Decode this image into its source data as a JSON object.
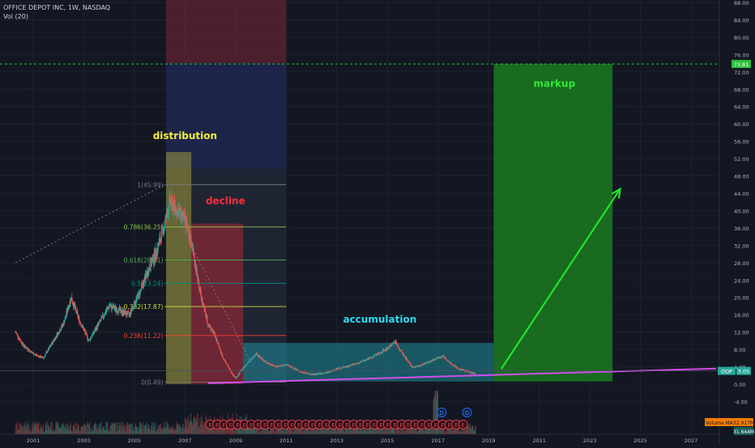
{
  "header": {
    "symbol_line": "OFFICE DEPOT INC, 1W, NASDAQ",
    "volume_line": "Vol (20)"
  },
  "colors": {
    "background": "#131722",
    "grid": "#1e2230",
    "axis_text": "#b2b5be",
    "up_candle": "#26a69a",
    "down_candle": "#ef5350",
    "trendline": "#d24ee8",
    "arrow": "#22e32a",
    "target_line": "#2fbf3c"
  },
  "chart_data": {
    "type": "candlestick",
    "title": "OFFICE DEPOT INC, 1W, NASDAQ",
    "ylim": [
      0,
      88
    ],
    "xlim": [
      2000.3,
      2028.0
    ],
    "y_ticks": [
      "-4.00",
      "0.00",
      "4.00",
      "8.00",
      "12.00",
      "16.00",
      "20.00",
      "24.00",
      "28.00",
      "32.00",
      "36.00",
      "40.00",
      "44.00",
      "48.00",
      "52.00",
      "56.00",
      "60.00",
      "64.00",
      "68.00",
      "72.00",
      "76.00",
      "80.00",
      "84.00",
      "88.00"
    ],
    "x_ticks": [
      "2001",
      "2003",
      "2005",
      "2007",
      "2009",
      "2011",
      "2013",
      "2015",
      "2017",
      "2019",
      "2021",
      "2023",
      "2025",
      "2027"
    ],
    "price_path": [
      [
        2000.3,
        12
      ],
      [
        2000.6,
        9
      ],
      [
        2001.0,
        7
      ],
      [
        2001.4,
        6
      ],
      [
        2001.8,
        10
      ],
      [
        2002.2,
        14
      ],
      [
        2002.5,
        20
      ],
      [
        2002.8,
        15
      ],
      [
        2003.2,
        10
      ],
      [
        2003.6,
        14
      ],
      [
        2004.0,
        18
      ],
      [
        2004.4,
        17
      ],
      [
        2004.8,
        16
      ],
      [
        2005.2,
        21
      ],
      [
        2005.6,
        27
      ],
      [
        2005.9,
        31
      ],
      [
        2006.2,
        37
      ],
      [
        2006.4,
        42
      ],
      [
        2006.7,
        40
      ],
      [
        2007.0,
        38
      ],
      [
        2007.3,
        31
      ],
      [
        2007.6,
        21
      ],
      [
        2007.9,
        14
      ],
      [
        2008.2,
        11
      ],
      [
        2008.5,
        6
      ],
      [
        2008.8,
        3
      ],
      [
        2009.0,
        1.2
      ],
      [
        2009.2,
        3
      ],
      [
        2009.5,
        5
      ],
      [
        2009.8,
        7
      ],
      [
        2010.2,
        5
      ],
      [
        2010.6,
        4
      ],
      [
        2011.0,
        4.5
      ],
      [
        2011.5,
        3
      ],
      [
        2012.0,
        2.2
      ],
      [
        2012.5,
        2.5
      ],
      [
        2013.0,
        3.5
      ],
      [
        2013.5,
        4.2
      ],
      [
        2014.0,
        5.2
      ],
      [
        2014.5,
        6.5
      ],
      [
        2015.0,
        8.2
      ],
      [
        2015.3,
        9.8
      ],
      [
        2015.6,
        7
      ],
      [
        2016.0,
        3.8
      ],
      [
        2016.4,
        4.5
      ],
      [
        2016.8,
        5.5
      ],
      [
        2017.2,
        6.5
      ],
      [
        2017.5,
        4.8
      ],
      [
        2017.8,
        3.5
      ],
      [
        2018.1,
        3.1
      ],
      [
        2018.3,
        2.6
      ],
      [
        2018.5,
        2.5
      ]
    ],
    "fibonacci": [
      {
        "ratio_label": "1(45.99)",
        "price": 45.99,
        "color": "#787b86"
      },
      {
        "ratio_label": "0.786(36.25)",
        "price": 36.25,
        "color": "#8bc34a"
      },
      {
        "ratio_label": "0.618(28.61)",
        "price": 28.61,
        "color": "#4caf50"
      },
      {
        "ratio_label": "0.5(23.24)",
        "price": 23.24,
        "color": "#009688"
      },
      {
        "ratio_label": "0.382(17.87)",
        "price": 17.87,
        "color": "#cddc39"
      },
      {
        "ratio_label": "0.236(11.22)",
        "price": 11.22,
        "color": "#f44336"
      },
      {
        "ratio_label": "0(0.49)",
        "price": 0.49,
        "color": "#787b86"
      }
    ],
    "zones": [
      {
        "label": "distribution",
        "x0": 2006.25,
        "x1": 2007.25,
        "y0": 0,
        "y1": 53.5,
        "fill": "#c7c03a",
        "opacity": 0.42,
        "text_color": "#f2ee3c"
      },
      {
        "label": "decline",
        "x0": 2007.25,
        "x1": 2009.3,
        "y0": 0,
        "y1": 37,
        "fill": "#d82c3a",
        "opacity": 0.42,
        "text_color": "#ff2d3a"
      },
      {
        "label": "accumulation",
        "x0": 2009.3,
        "x1": 2019.2,
        "y0": 0.6,
        "y1": 9.5,
        "fill": "#21a6b3",
        "opacity": 0.45,
        "text_color": "#2fd9ef"
      },
      {
        "label": "markup",
        "x0": 2019.2,
        "x1": 2023.9,
        "y0": 0.6,
        "y1": 73.8,
        "fill": "#1a7e1f",
        "opacity": 0.82,
        "text_color": "#34e83a"
      }
    ],
    "background_band": {
      "x0": 2006.25,
      "x1": 2011.0
    },
    "target": {
      "price": 73.81,
      "label": "73.81"
    },
    "current_price": {
      "symbol": "ODP",
      "label": "3.05",
      "price": 3.05
    },
    "trendline": {
      "x0": 2007.9,
      "y0": 0.2,
      "x1": 2028.0,
      "y1": 3.6
    },
    "arrow": {
      "x0": 2019.5,
      "y0": 3.5,
      "x1": 2024.2,
      "y1": 45.0
    },
    "dashed_fib_link": {
      "x0": 2000.3,
      "y0": 28.0,
      "x1": 2006.2,
      "y1": 45.99
    },
    "volume": {
      "label": "Volume MA",
      "ma_value": "32.917M",
      "secondary_value": "31.644M"
    },
    "event_markers": {
      "earnings_symbol": "E",
      "dividend_symbol": "D",
      "earnings_count": 38,
      "dividend_positions": [
        2017.15,
        2018.15
      ]
    }
  }
}
